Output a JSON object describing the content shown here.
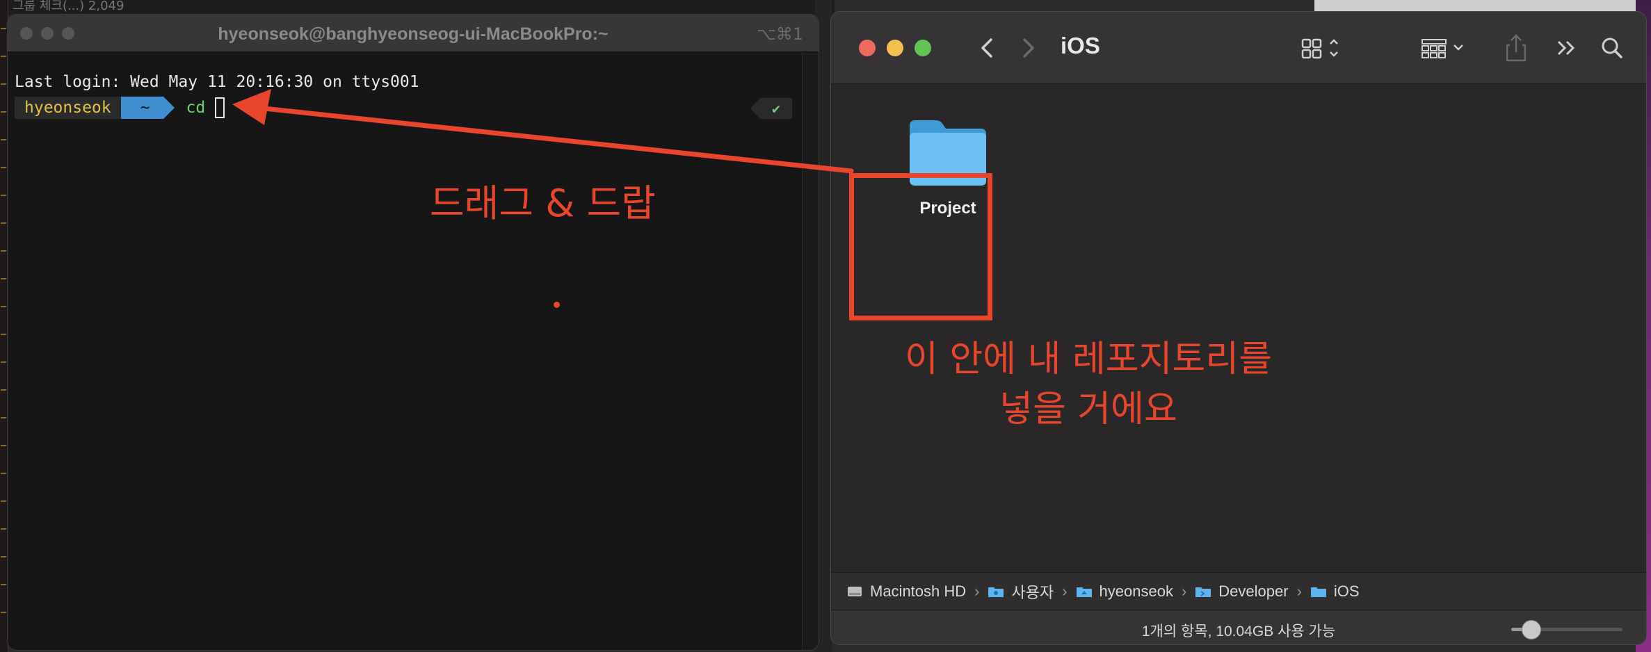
{
  "desktop": {
    "top_strip_text": "그룹 체크(...) 2,049"
  },
  "terminal": {
    "title": "hyeonseok@banghyeonseog-ui-MacBookPro:~",
    "shortcut": "⌥⌘1",
    "last_login": "Last login: Wed May 11 20:16:30 on ttys001",
    "prompt_user": "hyeonseok",
    "prompt_dir": "~",
    "command": "cd",
    "status_icon": "✔"
  },
  "annotations": {
    "drag_drop": "드래그 & 드랍",
    "repo_line1": "이 안에 내 레포지토리를",
    "repo_line2": "넣을 거에요",
    "color": "#e8452d"
  },
  "finder": {
    "title": "iOS",
    "items": [
      {
        "name": "Project",
        "icon": "folder-icon"
      }
    ],
    "path": [
      {
        "label": "Macintosh HD",
        "icon": "hard-drive-icon"
      },
      {
        "label": "사용자",
        "icon": "folder-icon"
      },
      {
        "label": "hyeonseok",
        "icon": "home-folder-icon"
      },
      {
        "label": "Developer",
        "icon": "developer-folder-icon"
      },
      {
        "label": "iOS",
        "icon": "folder-icon"
      }
    ],
    "status": "1개의 항목, 10.04GB 사용 가능",
    "icon_size_level": 0.18
  }
}
